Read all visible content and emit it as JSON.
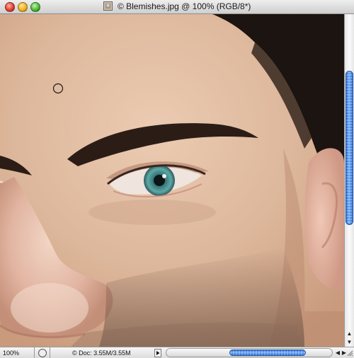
{
  "window": {
    "title": "© Blemishes.jpg @ 100% (RGB/8*)"
  },
  "canvas": {
    "image_description_icon": "photo-closeup-face",
    "cursor_icon": "brush-circle-cursor"
  },
  "statusbar": {
    "zoom": "100%",
    "doc_info": "© Doc: 3.55M/3.55M",
    "info_menu_icon": "triangle-right-icon"
  },
  "scroll": {
    "vertical_position": 0.25,
    "horizontal_position": 0.45
  },
  "colors": {
    "scroll_accent": "#3b7be0",
    "skin": "#d9b397",
    "hair": "#1c1410"
  }
}
